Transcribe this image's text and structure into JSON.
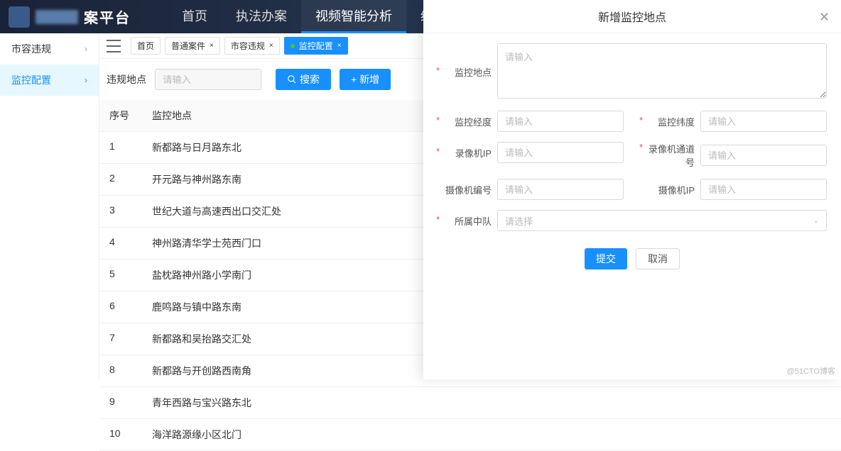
{
  "header": {
    "logo_suffix": "案平台",
    "nav": [
      "首页",
      "执法办案",
      "视频智能分析",
      "统计分析"
    ],
    "active_nav": 2
  },
  "sidebar": {
    "items": [
      {
        "label": "市容违规"
      },
      {
        "label": "监控配置"
      }
    ],
    "active": 1
  },
  "tabs": {
    "items": [
      {
        "label": "首页",
        "closable": false
      },
      {
        "label": "普通案件",
        "closable": true
      },
      {
        "label": "市容违规",
        "closable": true
      },
      {
        "label": "监控配置",
        "closable": true,
        "active": true,
        "dot": true
      }
    ]
  },
  "filter": {
    "label": "违规地点",
    "placeholder": "请输入",
    "search_btn": "搜索",
    "add_btn": "新增"
  },
  "table": {
    "columns": {
      "seq": "序号",
      "loc": "监控地点"
    },
    "rows": [
      {
        "seq": "1",
        "loc": "新都路与日月路东北"
      },
      {
        "seq": "2",
        "loc": "开元路与神州路东南"
      },
      {
        "seq": "3",
        "loc": "世纪大道与高速西出口交汇处"
      },
      {
        "seq": "4",
        "loc": "神州路清华学士苑西门口"
      },
      {
        "seq": "5",
        "loc": "盐枕路神州路小学南门"
      },
      {
        "seq": "6",
        "loc": "鹿鸣路与镇中路东南"
      },
      {
        "seq": "7",
        "loc": "新都路和吴抬路交汇处"
      },
      {
        "seq": "8",
        "loc": "新都路与开创路西南角"
      },
      {
        "seq": "9",
        "loc": "青年西路与宝兴路东北"
      },
      {
        "seq": "10",
        "loc": "海洋路源缘小区北门"
      }
    ]
  },
  "modal": {
    "title": "新增监控地点",
    "placeholder": "请输入",
    "select_placeholder": "请选择",
    "fields": {
      "location": "监控地点",
      "lng": "监控经度",
      "lat": "监控纬度",
      "recorder_ip": "录像机IP",
      "recorder_channel": "录像机通道号",
      "camera_no": "摄像机编号",
      "camera_ip": "摄像机IP",
      "team": "所属中队"
    },
    "submit": "提交",
    "cancel": "取消"
  },
  "watermark": "@51CTO博客"
}
